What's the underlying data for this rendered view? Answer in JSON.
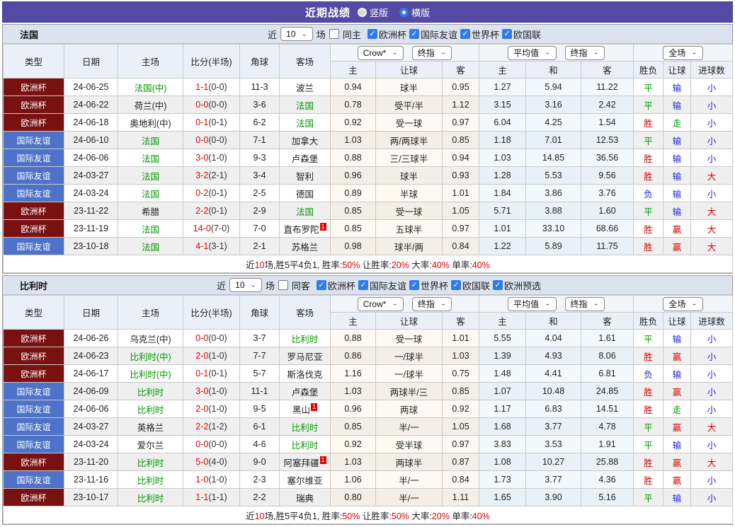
{
  "icons": {
    "chevron_down": "⌄",
    "check": "✓"
  },
  "colors": {
    "accent_purple": "#544AA3",
    "euro_red": "#7A1111",
    "friendly_blue": "#4E72C8",
    "win_red": "#DD0000",
    "draw_green": "#009900",
    "lose_blue": "#2222DD"
  },
  "titlebar": {
    "title": "近期战绩",
    "radios": [
      {
        "label": "竖版",
        "selected": true
      },
      {
        "label": "横版",
        "selected": false
      }
    ]
  },
  "sections": [
    {
      "title": "法国",
      "filter": {
        "near_label": "近",
        "count": "10",
        "games_label": "场",
        "same_label": "同主",
        "same_checked": false,
        "leagues": [
          "欧洲杯",
          "国际友谊",
          "世界杯",
          "欧国联"
        ]
      },
      "table": {
        "headers": {
          "type": "类型",
          "date": "日期",
          "home": "主场",
          "score": "比分(半场)",
          "corner": "角球",
          "away": "客场",
          "sub": [
            "主",
            "让球",
            "客",
            "主",
            "和",
            "客",
            "胜负",
            "让球",
            "进球数"
          ]
        },
        "dropdowns": {
          "bookmaker": "Crow*",
          "stage1": "终指",
          "average": "平均值",
          "stage2": "终指",
          "scope": "全场"
        }
      },
      "rows": [
        {
          "comp": "欧洲杯",
          "ctype": "euro",
          "date": "24-06-25",
          "home": "法国(中)",
          "hg": true,
          "ft": "1-1",
          "ht": "(0-0)",
          "corner": "11-3",
          "away": "波兰",
          "ag": false,
          "badge": "",
          "o1": "0.94",
          "hcap": "球半",
          "o2": "0.95",
          "m1": "1.27",
          "m2": "5.94",
          "m3": "11.22",
          "r1": [
            "平",
            "g"
          ],
          "r2": [
            "输",
            "b"
          ],
          "r3": [
            "小",
            "b"
          ]
        },
        {
          "comp": "欧洲杯",
          "ctype": "euro",
          "date": "24-06-22",
          "home": "荷兰(中)",
          "hg": false,
          "ft": "0-0",
          "ht": "(0-0)",
          "corner": "3-6",
          "away": "法国",
          "ag": true,
          "badge": "",
          "o1": "0.78",
          "hcap": "受平/半",
          "o2": "1.12",
          "m1": "3.15",
          "m2": "3.16",
          "m3": "2.42",
          "r1": [
            "平",
            "g"
          ],
          "r2": [
            "输",
            "b"
          ],
          "r3": [
            "小",
            "b"
          ]
        },
        {
          "comp": "欧洲杯",
          "ctype": "euro",
          "date": "24-06-18",
          "home": "奥地利(中)",
          "hg": false,
          "ft": "0-1",
          "ht": "(0-1)",
          "corner": "6-2",
          "away": "法国",
          "ag": true,
          "badge": "",
          "o1": "0.92",
          "hcap": "受一球",
          "o2": "0.97",
          "m1": "6.04",
          "m2": "4.25",
          "m3": "1.54",
          "r1": [
            "胜",
            "r"
          ],
          "r2": [
            "走",
            "g"
          ],
          "r3": [
            "小",
            "b"
          ]
        },
        {
          "comp": "国际友谊",
          "ctype": "friendly",
          "date": "24-06-10",
          "home": "法国",
          "hg": true,
          "ft": "0-0",
          "ht": "(0-0)",
          "corner": "7-1",
          "away": "加拿大",
          "ag": false,
          "badge": "",
          "o1": "1.03",
          "hcap": "两/两球半",
          "o2": "0.85",
          "m1": "1.18",
          "m2": "7.01",
          "m3": "12.53",
          "r1": [
            "平",
            "g"
          ],
          "r2": [
            "输",
            "b"
          ],
          "r3": [
            "小",
            "b"
          ]
        },
        {
          "comp": "国际友谊",
          "ctype": "friendly",
          "date": "24-06-06",
          "home": "法国",
          "hg": true,
          "ft": "3-0",
          "ht": "(1-0)",
          "corner": "9-3",
          "away": "卢森堡",
          "ag": false,
          "badge": "",
          "o1": "0.88",
          "hcap": "三/三球半",
          "o2": "0.94",
          "m1": "1.03",
          "m2": "14.85",
          "m3": "36.56",
          "r1": [
            "胜",
            "r"
          ],
          "r2": [
            "输",
            "b"
          ],
          "r3": [
            "小",
            "b"
          ]
        },
        {
          "comp": "国际友谊",
          "ctype": "friendly",
          "date": "24-03-27",
          "home": "法国",
          "hg": true,
          "ft": "3-2",
          "ht": "(2-1)",
          "corner": "3-4",
          "away": "智利",
          "ag": false,
          "badge": "",
          "o1": "0.96",
          "hcap": "球半",
          "o2": "0.93",
          "m1": "1.28",
          "m2": "5.53",
          "m3": "9.56",
          "r1": [
            "胜",
            "r"
          ],
          "r2": [
            "输",
            "b"
          ],
          "r3": [
            "大",
            "r"
          ]
        },
        {
          "comp": "国际友谊",
          "ctype": "friendly",
          "date": "24-03-24",
          "home": "法国",
          "hg": true,
          "ft": "0-2",
          "ht": "(0-1)",
          "corner": "2-5",
          "away": "德国",
          "ag": false,
          "badge": "",
          "o1": "0.89",
          "hcap": "半球",
          "o2": "1.01",
          "m1": "1.84",
          "m2": "3.86",
          "m3": "3.76",
          "r1": [
            "负",
            "b"
          ],
          "r2": [
            "输",
            "b"
          ],
          "r3": [
            "小",
            "b"
          ]
        },
        {
          "comp": "欧洲杯",
          "ctype": "euro",
          "date": "23-11-22",
          "home": "希腊",
          "hg": false,
          "ft": "2-2",
          "ht": "(0-1)",
          "corner": "2-9",
          "away": "法国",
          "ag": true,
          "badge": "",
          "o1": "0.85",
          "hcap": "受一球",
          "o2": "1.05",
          "m1": "5.71",
          "m2": "3.88",
          "m3": "1.60",
          "r1": [
            "平",
            "g"
          ],
          "r2": [
            "输",
            "b"
          ],
          "r3": [
            "大",
            "r"
          ]
        },
        {
          "comp": "欧洲杯",
          "ctype": "euro",
          "date": "23-11-19",
          "home": "法国",
          "hg": true,
          "ft": "14-0",
          "ht": "(7-0)",
          "corner": "7-0",
          "away": "直布罗陀",
          "ag": false,
          "badge": "1",
          "o1": "0.85",
          "hcap": "五球半",
          "o2": "0.97",
          "m1": "1.01",
          "m2": "33.10",
          "m3": "68.66",
          "r1": [
            "胜",
            "r"
          ],
          "r2": [
            "赢",
            "r"
          ],
          "r3": [
            "大",
            "r"
          ]
        },
        {
          "comp": "国际友谊",
          "ctype": "friendly",
          "date": "23-10-18",
          "home": "法国",
          "hg": true,
          "ft": "4-1",
          "ht": "(3-1)",
          "corner": "2-1",
          "away": "苏格兰",
          "ag": false,
          "badge": "",
          "o1": "0.98",
          "hcap": "球半/两",
          "o2": "0.84",
          "m1": "1.22",
          "m2": "5.89",
          "m3": "11.75",
          "r1": [
            "胜",
            "r"
          ],
          "r2": [
            "赢",
            "r"
          ],
          "r3": [
            "大",
            "r"
          ]
        }
      ],
      "summary": [
        {
          "t": "近"
        },
        {
          "t": "10",
          "red": true
        },
        {
          "t": "场,胜5平4负1, 胜率:"
        },
        {
          "t": "50%",
          "red": true
        },
        {
          "t": " 让胜率:"
        },
        {
          "t": "20%",
          "red": true
        },
        {
          "t": " 大率:"
        },
        {
          "t": "40%",
          "red": true
        },
        {
          "t": " 单率:"
        },
        {
          "t": "40%",
          "red": true
        }
      ]
    },
    {
      "title": "比利时",
      "filter": {
        "near_label": "近",
        "count": "10",
        "games_label": "场",
        "same_label": "同客",
        "same_checked": false,
        "leagues": [
          "欧洲杯",
          "国际友谊",
          "世界杯",
          "欧国联",
          "欧洲预选"
        ]
      },
      "table": {
        "headers": {
          "type": "类型",
          "date": "日期",
          "home": "主场",
          "score": "比分(半场)",
          "corner": "角球",
          "away": "客场",
          "sub": [
            "主",
            "让球",
            "客",
            "主",
            "和",
            "客",
            "胜负",
            "让球",
            "进球数"
          ]
        },
        "dropdowns": {
          "bookmaker": "Crow*",
          "stage1": "终指",
          "average": "平均值",
          "stage2": "终指",
          "scope": "全场"
        }
      },
      "rows": [
        {
          "comp": "欧洲杯",
          "ctype": "euro",
          "date": "24-06-26",
          "home": "乌克兰(中)",
          "hg": false,
          "ft": "0-0",
          "ht": "(0-0)",
          "corner": "3-7",
          "away": "比利时",
          "ag": true,
          "badge": "",
          "o1": "0.88",
          "hcap": "受一球",
          "o2": "1.01",
          "m1": "5.55",
          "m2": "4.04",
          "m3": "1.61",
          "r1": [
            "平",
            "g"
          ],
          "r2": [
            "输",
            "b"
          ],
          "r3": [
            "小",
            "b"
          ]
        },
        {
          "comp": "欧洲杯",
          "ctype": "euro",
          "date": "24-06-23",
          "home": "比利时(中)",
          "hg": true,
          "ft": "2-0",
          "ht": "(1-0)",
          "corner": "7-7",
          "away": "罗马尼亚",
          "ag": false,
          "badge": "",
          "o1": "0.86",
          "hcap": "一/球半",
          "o2": "1.03",
          "m1": "1.39",
          "m2": "4.93",
          "m3": "8.06",
          "r1": [
            "胜",
            "r"
          ],
          "r2": [
            "赢",
            "r"
          ],
          "r3": [
            "小",
            "b"
          ]
        },
        {
          "comp": "欧洲杯",
          "ctype": "euro",
          "date": "24-06-17",
          "home": "比利时(中)",
          "hg": true,
          "ft": "0-1",
          "ht": "(0-1)",
          "corner": "5-7",
          "away": "斯洛伐克",
          "ag": false,
          "badge": "",
          "o1": "1.16",
          "hcap": "一/球半",
          "o2": "0.75",
          "m1": "1.48",
          "m2": "4.41",
          "m3": "6.81",
          "r1": [
            "负",
            "b"
          ],
          "r2": [
            "输",
            "b"
          ],
          "r3": [
            "小",
            "b"
          ]
        },
        {
          "comp": "国际友谊",
          "ctype": "friendly",
          "date": "24-06-09",
          "home": "比利时",
          "hg": true,
          "ft": "3-0",
          "ht": "(1-0)",
          "corner": "11-1",
          "away": "卢森堡",
          "ag": false,
          "badge": "",
          "o1": "1.03",
          "hcap": "两球半/三",
          "o2": "0.85",
          "m1": "1.07",
          "m2": "10.48",
          "m3": "24.85",
          "r1": [
            "胜",
            "r"
          ],
          "r2": [
            "赢",
            "r"
          ],
          "r3": [
            "小",
            "b"
          ]
        },
        {
          "comp": "国际友谊",
          "ctype": "friendly",
          "date": "24-06-06",
          "home": "比利时",
          "hg": true,
          "ft": "2-0",
          "ht": "(1-0)",
          "corner": "9-5",
          "away": "黑山",
          "ag": false,
          "badge": "1",
          "o1": "0.96",
          "hcap": "两球",
          "o2": "0.92",
          "m1": "1.17",
          "m2": "6.83",
          "m3": "14.51",
          "r1": [
            "胜",
            "r"
          ],
          "r2": [
            "走",
            "g"
          ],
          "r3": [
            "小",
            "b"
          ]
        },
        {
          "comp": "国际友谊",
          "ctype": "friendly",
          "date": "24-03-27",
          "home": "英格兰",
          "hg": false,
          "ft": "2-2",
          "ht": "(1-2)",
          "corner": "6-1",
          "away": "比利时",
          "ag": true,
          "badge": "",
          "o1": "0.85",
          "hcap": "半/一",
          "o2": "1.05",
          "m1": "1.68",
          "m2": "3.77",
          "m3": "4.78",
          "r1": [
            "平",
            "g"
          ],
          "r2": [
            "赢",
            "r"
          ],
          "r3": [
            "大",
            "r"
          ]
        },
        {
          "comp": "国际友谊",
          "ctype": "friendly",
          "date": "24-03-24",
          "home": "爱尔兰",
          "hg": false,
          "ft": "0-0",
          "ht": "(0-0)",
          "corner": "4-6",
          "away": "比利时",
          "ag": true,
          "badge": "",
          "o1": "0.92",
          "hcap": "受半球",
          "o2": "0.97",
          "m1": "3.83",
          "m2": "3.53",
          "m3": "1.91",
          "r1": [
            "平",
            "g"
          ],
          "r2": [
            "输",
            "b"
          ],
          "r3": [
            "小",
            "b"
          ]
        },
        {
          "comp": "欧洲杯",
          "ctype": "euro",
          "date": "23-11-20",
          "home": "比利时",
          "hg": true,
          "ft": "5-0",
          "ht": "(4-0)",
          "corner": "9-0",
          "away": "阿塞拜疆",
          "ag": false,
          "badge": "1",
          "o1": "1.03",
          "hcap": "两球半",
          "o2": "0.87",
          "m1": "1.08",
          "m2": "10.27",
          "m3": "25.88",
          "r1": [
            "胜",
            "r"
          ],
          "r2": [
            "赢",
            "r"
          ],
          "r3": [
            "大",
            "r"
          ]
        },
        {
          "comp": "国际友谊",
          "ctype": "friendly",
          "date": "23-11-16",
          "home": "比利时",
          "hg": true,
          "ft": "1-0",
          "ht": "(1-0)",
          "corner": "2-3",
          "away": "塞尔维亚",
          "ag": false,
          "badge": "",
          "o1": "1.06",
          "hcap": "半/一",
          "o2": "0.84",
          "m1": "1.73",
          "m2": "3.77",
          "m3": "4.36",
          "r1": [
            "胜",
            "r"
          ],
          "r2": [
            "赢",
            "r"
          ],
          "r3": [
            "小",
            "b"
          ]
        },
        {
          "comp": "欧洲杯",
          "ctype": "euro",
          "date": "23-10-17",
          "home": "比利时",
          "hg": true,
          "ft": "1-1",
          "ht": "(1-1)",
          "corner": "2-2",
          "away": "瑞典",
          "ag": false,
          "badge": "",
          "o1": "0.80",
          "hcap": "半/一",
          "o2": "1.11",
          "m1": "1.65",
          "m2": "3.90",
          "m3": "5.16",
          "r1": [
            "平",
            "g"
          ],
          "r2": [
            "输",
            "b"
          ],
          "r3": [
            "小",
            "b"
          ]
        }
      ],
      "summary": [
        {
          "t": "近"
        },
        {
          "t": "10",
          "red": true
        },
        {
          "t": "场,胜5平4负1, 胜率:"
        },
        {
          "t": "50%",
          "red": true
        },
        {
          "t": " 让胜率:"
        },
        {
          "t": "50%",
          "red": true
        },
        {
          "t": " 大率:"
        },
        {
          "t": "20%",
          "red": true
        },
        {
          "t": " 单率:"
        },
        {
          "t": "40%",
          "red": true
        }
      ]
    }
  ]
}
